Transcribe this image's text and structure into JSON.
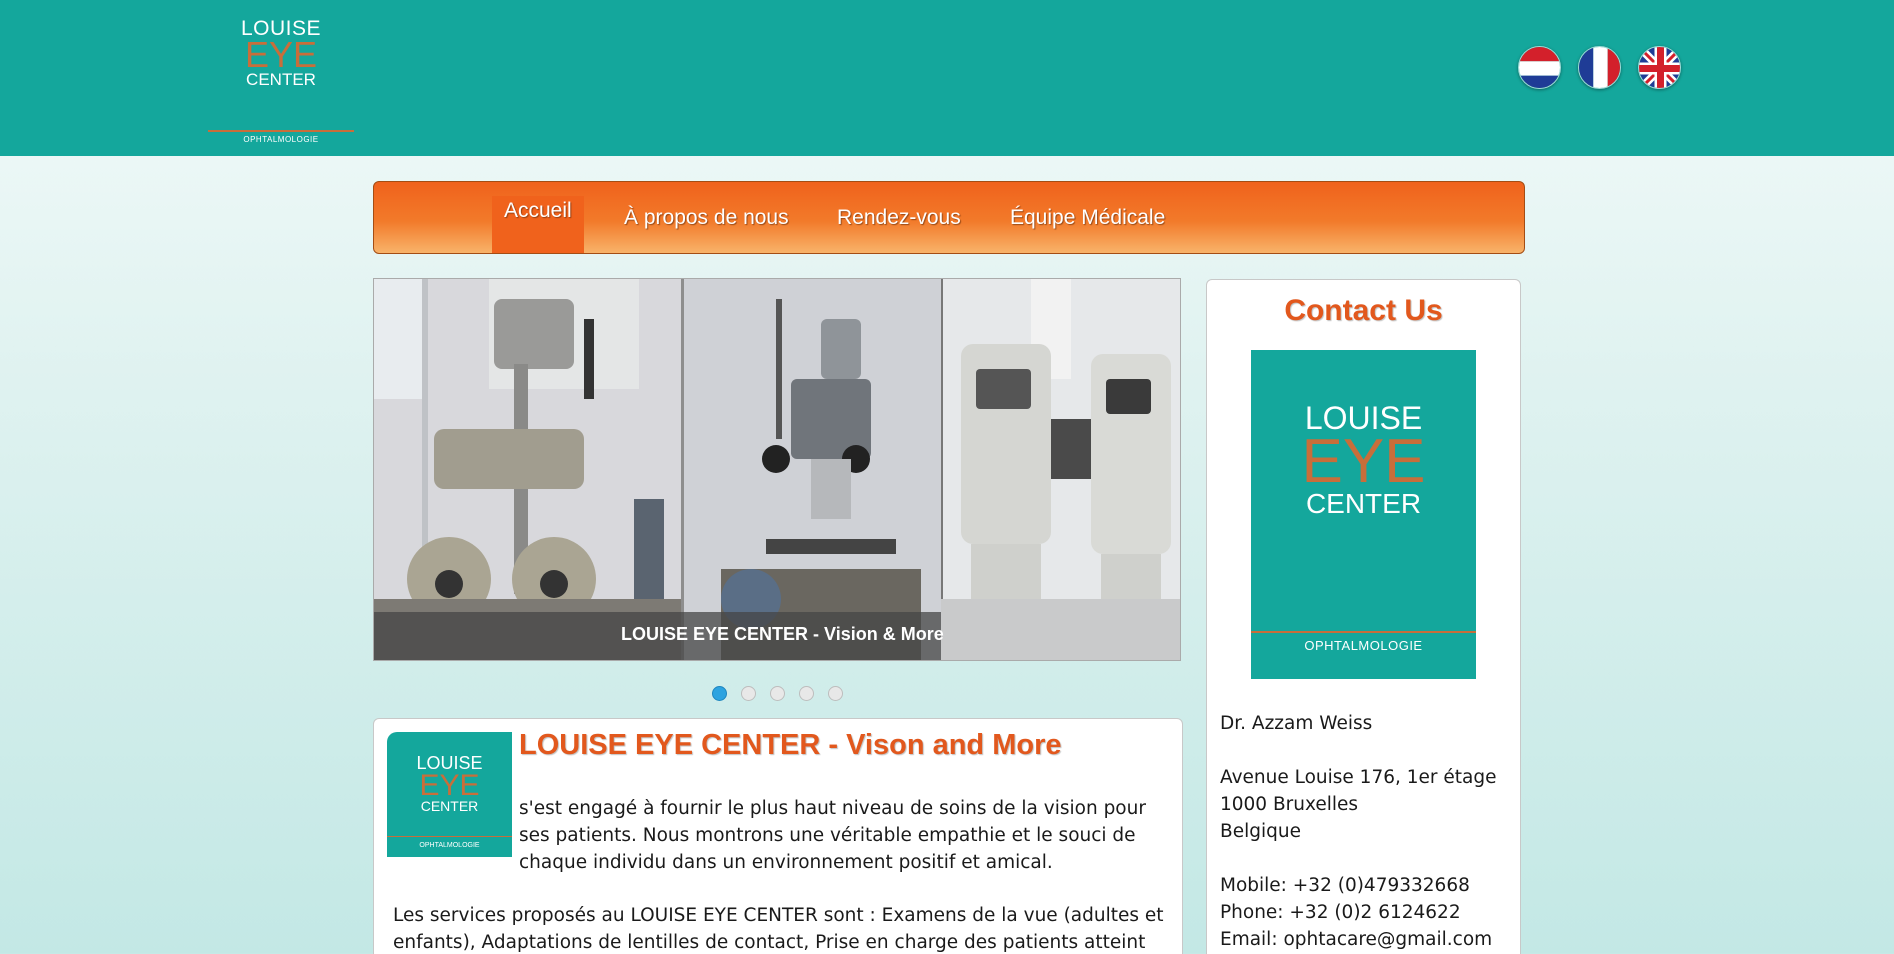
{
  "header": {
    "logo": {
      "line1": "LOUISE",
      "line2": "EYE",
      "line3": "CENTER",
      "line4": "OPHTALMOLOGIE"
    },
    "languages": [
      {
        "code": "nl",
        "icon": "netherlands-flag-icon"
      },
      {
        "code": "fr",
        "icon": "france-flag-icon"
      },
      {
        "code": "en",
        "icon": "uk-flag-icon"
      }
    ]
  },
  "nav": {
    "items": [
      {
        "label": "Accueil",
        "active": true
      },
      {
        "label": "À propos de nous",
        "active": false
      },
      {
        "label": "Rendez-vous",
        "active": false
      },
      {
        "label": "Équipe Médicale",
        "active": false
      }
    ]
  },
  "slider": {
    "caption": "LOUISE EYE CENTER - Vision & More",
    "slides": 5,
    "active_slide": 1
  },
  "welcome": {
    "logo": {
      "line1": "LOUISE",
      "line2": "EYE",
      "line3": "CENTER",
      "line4": "OPHTALMOLOGIE"
    },
    "title": "LOUISE EYE CENTER - Vison and More",
    "intro": "s'est engagé à fournir le plus haut niveau de soins de la vision pour ses patients. Nous montrons une véritable empathie et le souci de chaque individu dans un environnement positif et amical.",
    "services": "Les services proposés au LOUISE EYE CENTER sont : Examens de la vue (adultes et enfants), Adaptations de lentilles de contact, Prise en charge des patients atteint de"
  },
  "contact": {
    "title": "Contact Us",
    "logo": {
      "line1": "LOUISE",
      "line2": "EYE",
      "line3": "CENTER",
      "line4": "OPHTALMOLOGIE"
    },
    "doctor": "Dr. Azzam Weiss",
    "address1": "Avenue Louise 176, 1er étage",
    "address2": "1000 Bruxelles",
    "address3": "Belgique",
    "mobile": "Mobile: +32 (0)479332668",
    "phone": "Phone: +32 (0)2 6124622",
    "email": "Email: ophtacare@gmail.com"
  },
  "colors": {
    "header_bg": "#14a79c",
    "nav_orange": "#f0621c",
    "title_orange": "#e2581d",
    "logo_copper": "#c86e3a",
    "dot_active": "#2da3e0"
  }
}
